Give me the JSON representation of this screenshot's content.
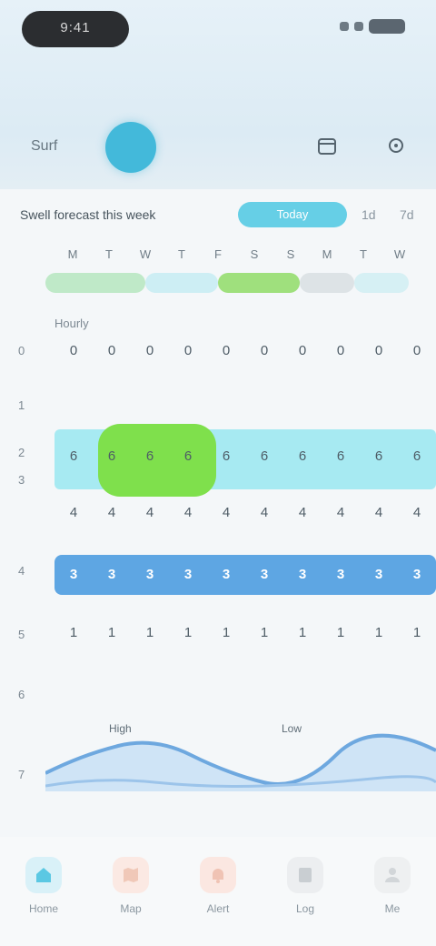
{
  "status_bar": {
    "time": "9:41"
  },
  "header": {
    "location_label": "Surf",
    "icon_a": "calendar-icon",
    "icon_b": "settings-icon"
  },
  "filter": {
    "summary": "Swell forecast this week",
    "active_pill": "Today",
    "extra_1": "1d",
    "extra_2": "7d"
  },
  "days": [
    "M",
    "T",
    "W",
    "T",
    "F",
    "S",
    "S",
    "M",
    "T",
    "W"
  ],
  "forecast": {
    "hours_title": "Hourly",
    "axis_labels": [
      "0",
      "1",
      "2",
      "3",
      "4",
      "5",
      "6",
      "7"
    ],
    "row_1": [
      "0",
      "0",
      "0",
      "0",
      "0",
      "0",
      "0",
      "0",
      "0",
      "0"
    ],
    "row_2": [
      "6",
      "6",
      "6",
      "6",
      "6",
      "6",
      "6",
      "6",
      "6",
      "6"
    ],
    "row_3": [
      "4",
      "4",
      "4",
      "4",
      "4",
      "4",
      "4",
      "4",
      "4",
      "4"
    ],
    "row_4": [
      "3",
      "3",
      "3",
      "3",
      "3",
      "3",
      "3",
      "3",
      "3",
      "3"
    ],
    "row_5": [
      "1",
      "1",
      "1",
      "1",
      "1",
      "1",
      "1",
      "1",
      "1",
      "1"
    ],
    "highlight_color": "#7fe04c",
    "meter_color": "#a2e8ef",
    "blue_row_color": "#5ea6e3"
  },
  "wave": {
    "left_label": "High",
    "right_label": "Low"
  },
  "tabs": [
    {
      "label": "Home",
      "icon": "home-icon",
      "color": "#5bc8e3"
    },
    {
      "label": "Map",
      "icon": "map-icon",
      "color": "#f0c8b8"
    },
    {
      "label": "Alert",
      "icon": "bell-icon",
      "color": "#f0c3b4"
    },
    {
      "label": "Log",
      "icon": "book-icon",
      "color": "#c9ced2"
    },
    {
      "label": "Me",
      "icon": "user-icon",
      "color": "#d2d6d9"
    }
  ]
}
